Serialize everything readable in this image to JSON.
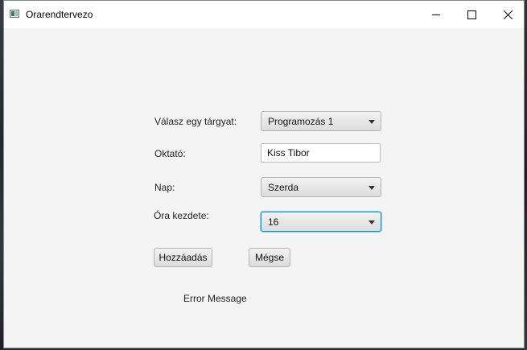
{
  "window": {
    "title": "Orarendtervezo"
  },
  "form": {
    "subject_label": "Válasz egy tárgyat:",
    "subject_value": "Programozás 1",
    "teacher_label": "Oktató:",
    "teacher_value": "Kiss Tibor",
    "day_label": "Nap:",
    "day_value": "Szerda",
    "hour_label": "Óra kezdete:",
    "hour_value": "16"
  },
  "buttons": {
    "add_label": "Hozzáadás",
    "cancel_label": "Mégse"
  },
  "status": {
    "error_message": "Error Message"
  },
  "icons": {
    "app": "app-window-icon",
    "minimize": "minimize-icon",
    "maximize": "maximize-icon",
    "close": "close-icon",
    "dropdown": "chevron-down-icon"
  }
}
